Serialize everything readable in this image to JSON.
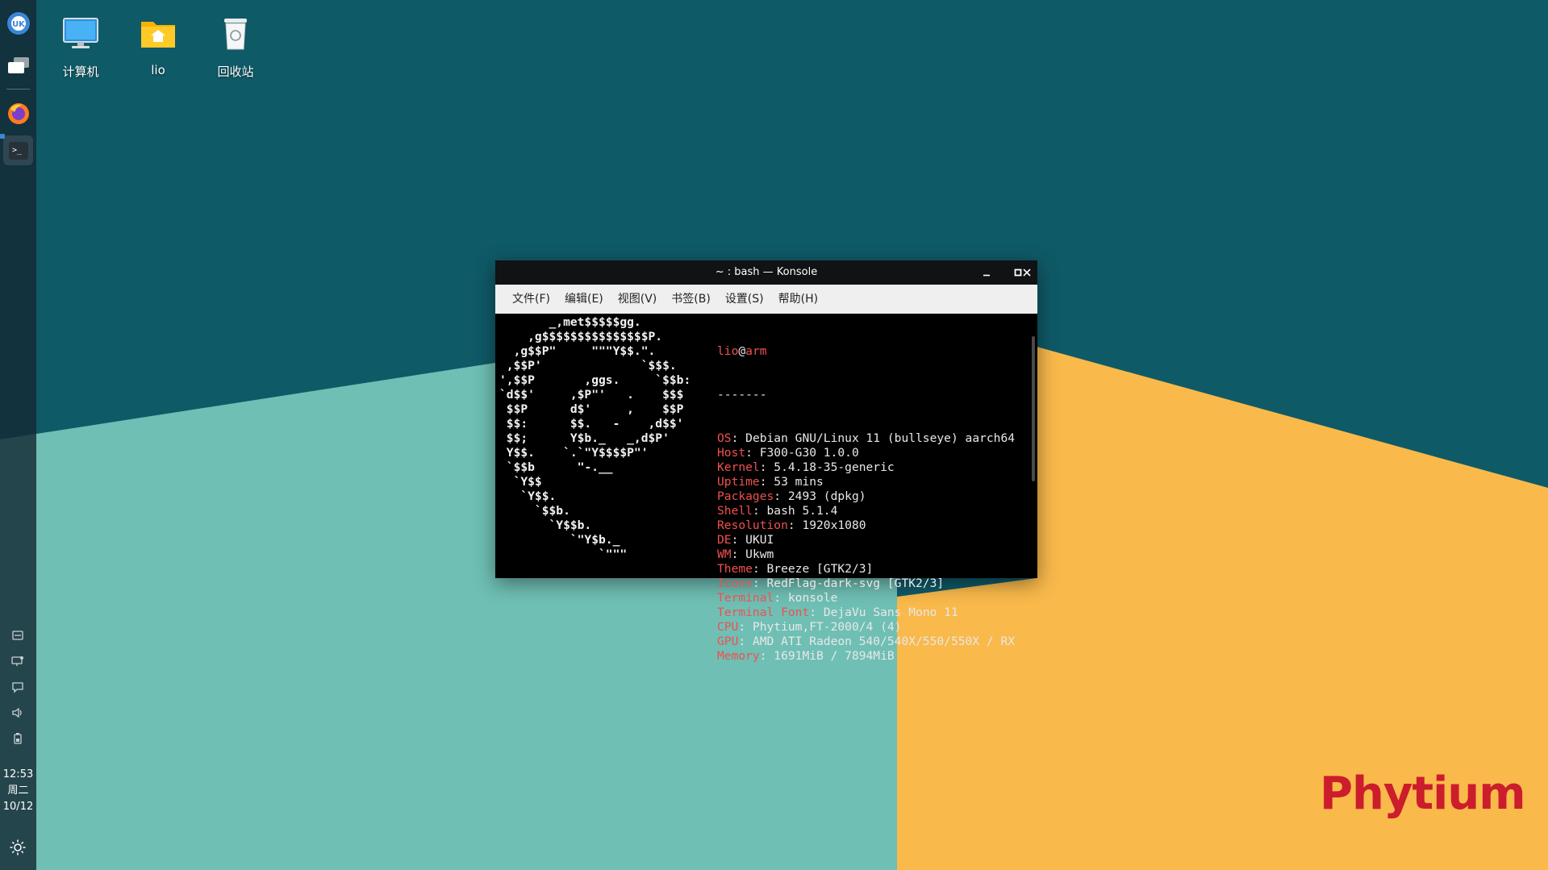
{
  "wallpaper": {
    "colors": {
      "top": "#0f5a67",
      "teal": "#6fbfb4",
      "orange": "#f9b94b"
    },
    "brand_text": "Phytium",
    "brand_color": "#cc1d2c"
  },
  "desktop_icons": [
    {
      "label": "计算机",
      "icon": "computer-icon"
    },
    {
      "label": "lio",
      "icon": "home-folder-icon"
    },
    {
      "label": "回收站",
      "icon": "trash-icon"
    }
  ],
  "panel": {
    "apps": [
      {
        "name": "start-menu-icon"
      },
      {
        "name": "multitask-view-icon"
      },
      {
        "name": "firefox-icon"
      },
      {
        "name": "konsole-taskbar-icon",
        "active": true
      }
    ],
    "tray": [
      "input-method-icon",
      "network-icon",
      "notification-icon",
      "volume-icon",
      "battery-icon"
    ],
    "clock": {
      "time": "12:53",
      "weekday": "周二",
      "date": "10/12"
    },
    "night-mode": "brightness-icon"
  },
  "konsole": {
    "title": "~ : bash — Konsole",
    "menu": [
      "文件(F)",
      "编辑(E)",
      "视图(V)",
      "书签(B)",
      "设置(S)",
      "帮助(H)"
    ],
    "user": "lio",
    "at": "@",
    "host": "arm",
    "separator": "-------",
    "info": [
      {
        "key": "OS",
        "value": "Debian GNU/Linux 11 (bullseye) aarch64"
      },
      {
        "key": "Host",
        "value": "F300-G30 1.0.0"
      },
      {
        "key": "Kernel",
        "value": "5.4.18-35-generic"
      },
      {
        "key": "Uptime",
        "value": "53 mins"
      },
      {
        "key": "Packages",
        "value": "2493 (dpkg)"
      },
      {
        "key": "Shell",
        "value": "bash 5.1.4"
      },
      {
        "key": "Resolution",
        "value": "1920x1080"
      },
      {
        "key": "DE",
        "value": "UKUI"
      },
      {
        "key": "WM",
        "value": "Ukwm"
      },
      {
        "key": "Theme",
        "value": "Breeze [GTK2/3]"
      },
      {
        "key": "Icons",
        "value": "RedFlag-dark-svg [GTK2/3]"
      },
      {
        "key": "Terminal",
        "value": "konsole"
      },
      {
        "key": "Terminal Font",
        "value": "DejaVu Sans Mono 11"
      },
      {
        "key": "CPU",
        "value": "Phytium,FT-2000/4 (4)"
      },
      {
        "key": "GPU",
        "value": "AMD ATI Radeon 540/540X/550/550X / RX"
      },
      {
        "key": "Memory",
        "value": "1691MiB / 7894MiB"
      }
    ],
    "ascii_logo": [
      "       _,met$$$$$gg.",
      "    ,g$$$$$$$$$$$$$$$P.",
      "  ,g$$P\"     \"\"\"Y$$.\".",
      " ,$$P'              `$$$.",
      "',$$P       ,ggs.     `$$b:",
      "`d$$'     ,$P\"'   .    $$$",
      " $$P      d$'     ,    $$P",
      " $$:      $$.   -    ,d$$'",
      " $$;      Y$b._   _,d$P'",
      " Y$$.    `.`\"Y$$$$P\"'",
      " `$$b      \"-.__",
      "  `Y$$",
      "   `Y$$.",
      "     `$$b.",
      "       `Y$$b.",
      "          `\"Y$b._",
      "              `\"\"\""
    ]
  }
}
